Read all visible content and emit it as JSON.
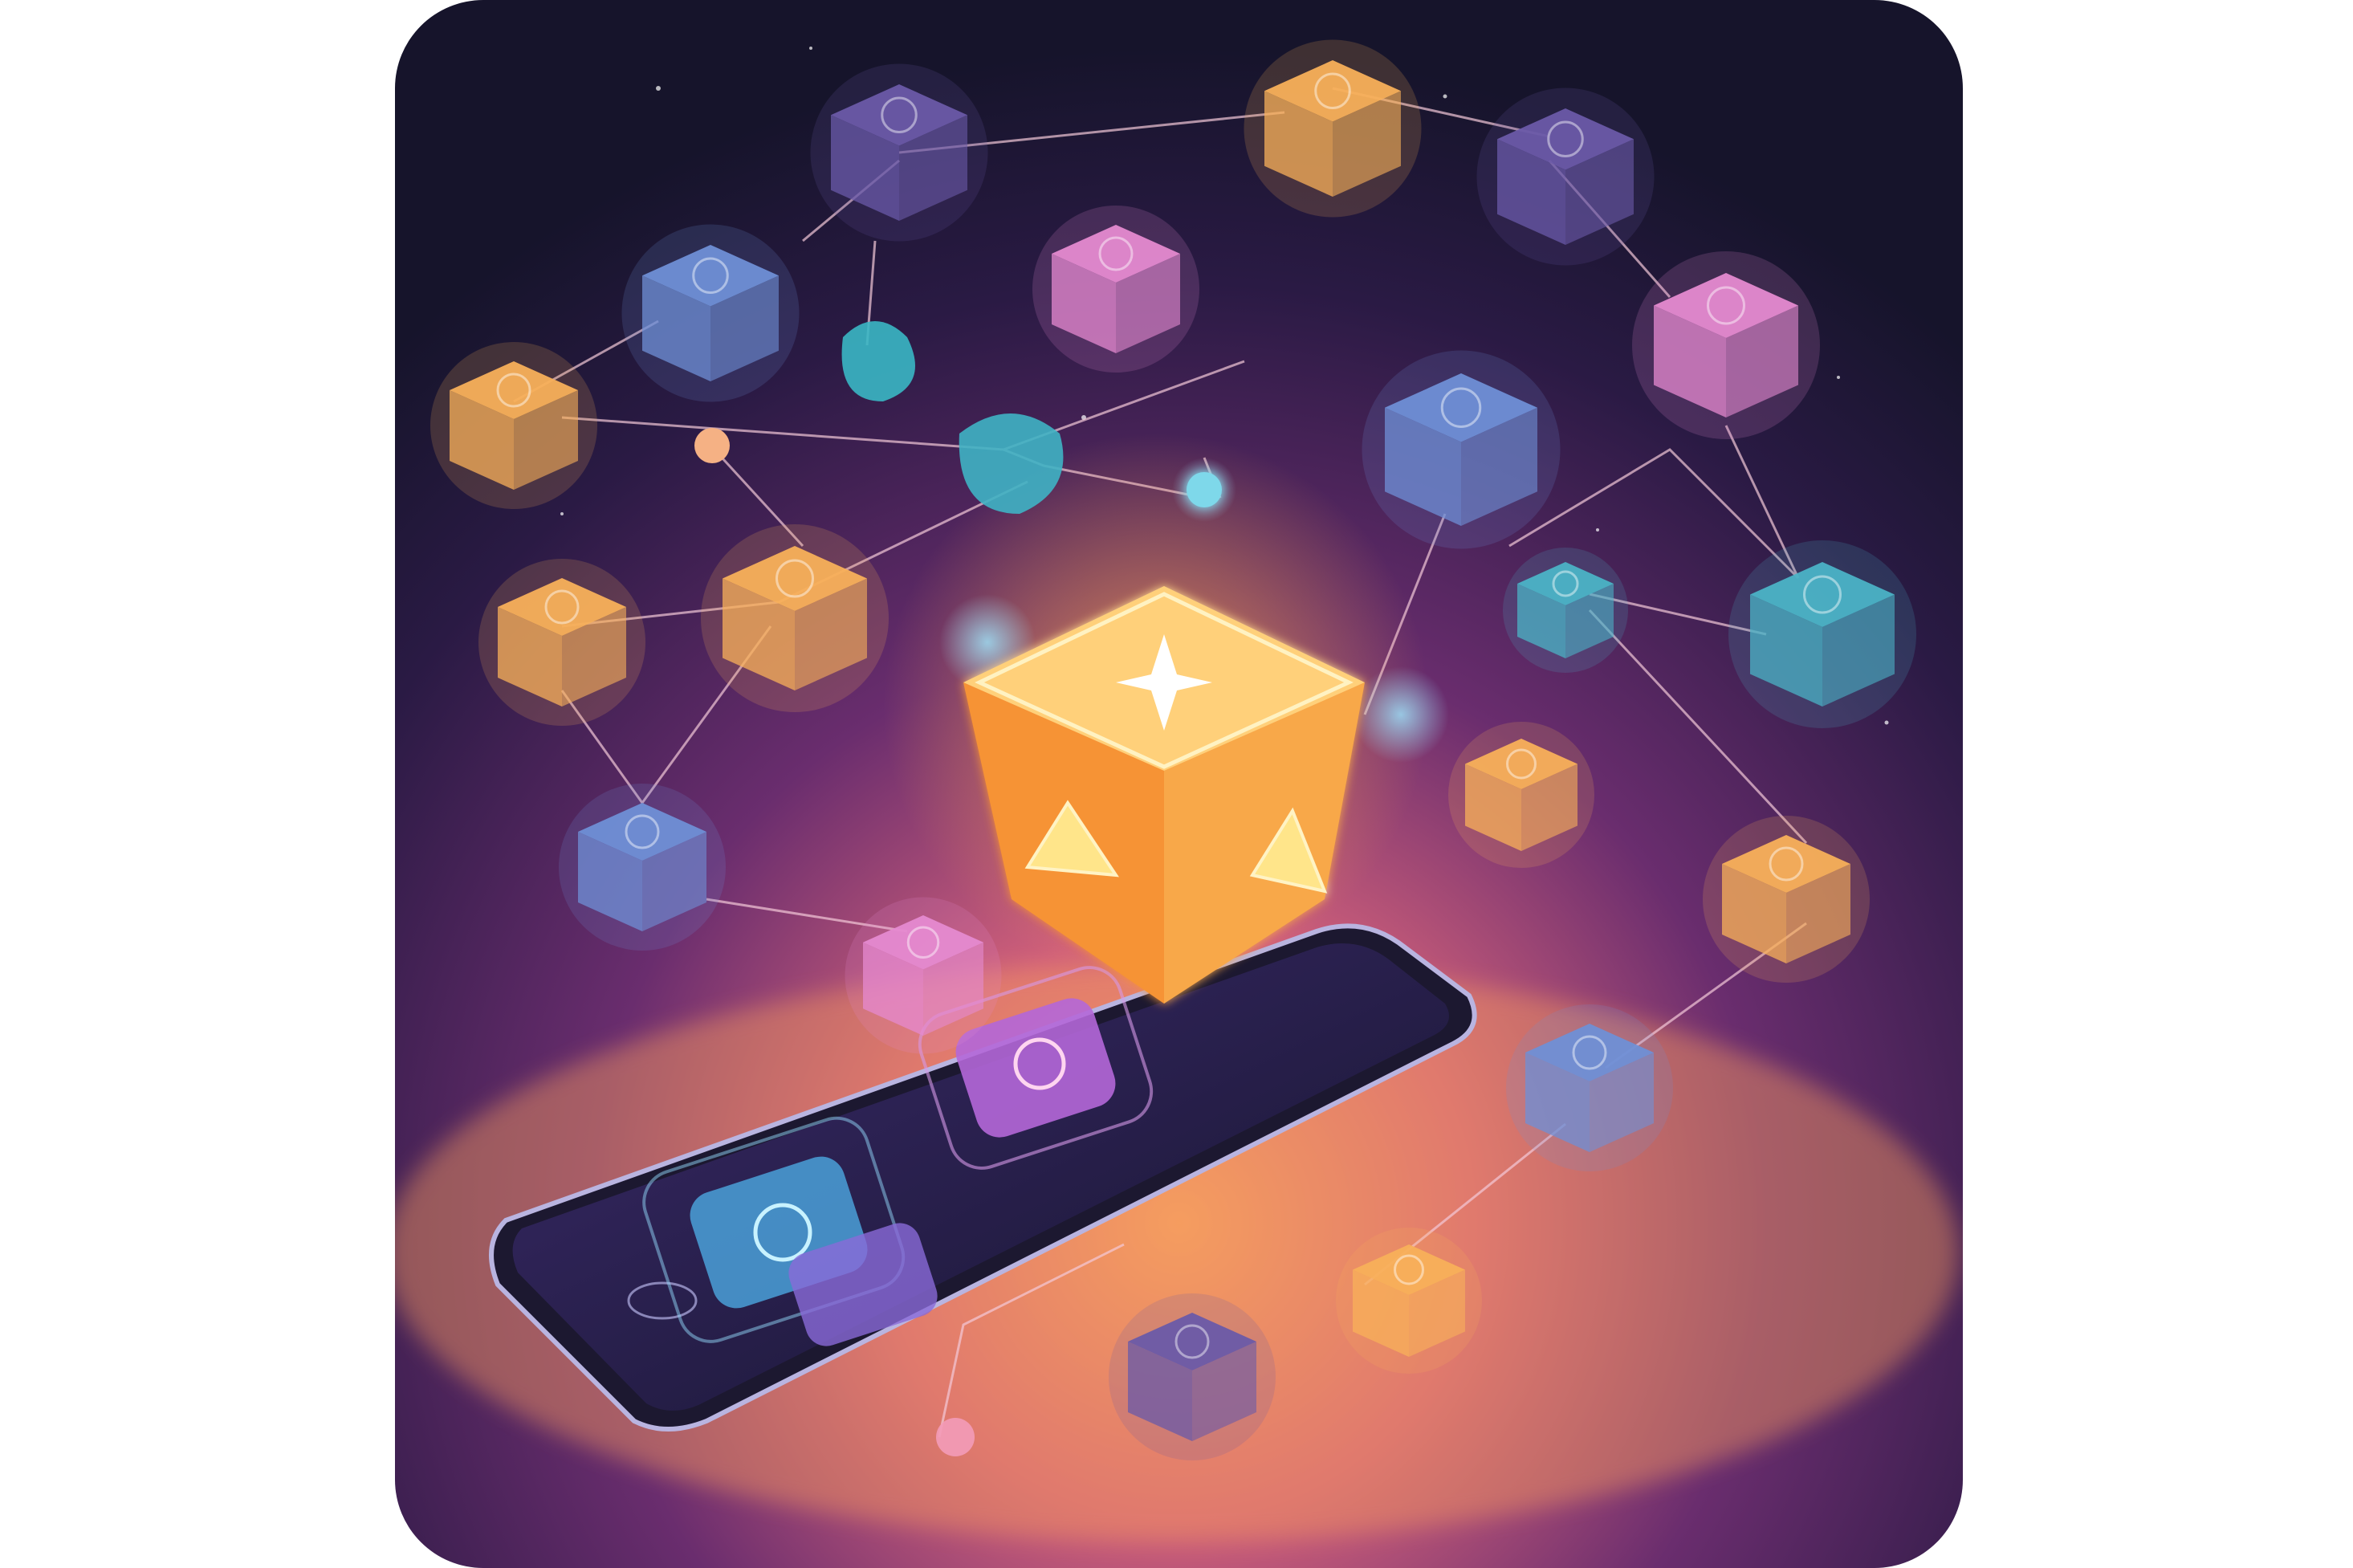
{
  "illustration": {
    "subject": "glowing-cube-network-over-smartphone",
    "colors": {
      "page_background": "#ffffff",
      "card_background_top": "#16142b",
      "card_background_mid": "#3a1c4f",
      "card_glow_bottom": "#f0895a",
      "central_cube": "#f6a13a",
      "orange_cube": "#f8b05a",
      "pink_cube": "#e58ad0",
      "blue_cube": "#6f8fd6",
      "teal_cube": "#4bb3c6",
      "purple_cube": "#6a5aa8",
      "connector_line": "#f3c9d8",
      "phone_body": "#1c1830",
      "phone_screen": "#2a2350"
    },
    "icons": [
      "star-icon",
      "app-tile-icon"
    ]
  }
}
